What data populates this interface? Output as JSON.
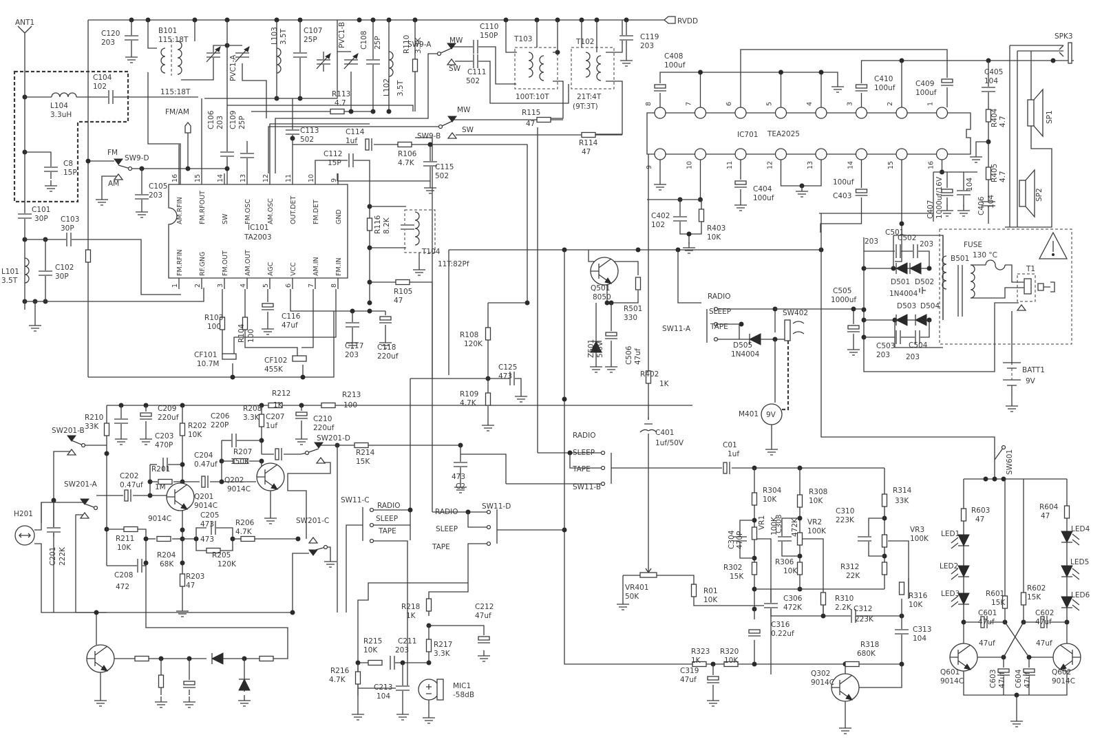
{
  "title": "AM/FM radio cassette schematic",
  "colors": {
    "ink": "#3a3a3a",
    "background": "#ffffff"
  },
  "nets": {
    "rvdd": "RVDD",
    "fm_am": "FM/AM"
  },
  "antenna": {
    "ref": "ANT1"
  },
  "ic101": {
    "ref": "IC101",
    "part": "TA2003",
    "top_pins": [
      {
        "n": "16",
        "name": "AM.RFIN"
      },
      {
        "n": "15",
        "name": "FM.RFOUT"
      },
      {
        "n": "14",
        "name": "SW"
      },
      {
        "n": "13",
        "name": "FM.OSC"
      },
      {
        "n": "12",
        "name": "AM.OSC"
      },
      {
        "n": "11",
        "name": "OUT.DET"
      },
      {
        "n": "10",
        "name": "FM.DET"
      },
      {
        "n": "9",
        "name": "GND"
      }
    ],
    "bottom_pins": [
      {
        "n": "1",
        "name": "FM.RFIN"
      },
      {
        "n": "2",
        "name": "RF.GNG"
      },
      {
        "n": "3",
        "name": "FM.OUT"
      },
      {
        "n": "4",
        "name": "AM.OUT"
      },
      {
        "n": "5",
        "name": "AGC"
      },
      {
        "n": "6",
        "name": "VCC"
      },
      {
        "n": "7",
        "name": "AM.IN"
      },
      {
        "n": "8",
        "name": "FM.IN"
      }
    ]
  },
  "ic701": {
    "ref": "IC701",
    "part": "TEA2025",
    "top_pins": [
      "8",
      "7",
      "6",
      "5",
      "4",
      "3",
      "2",
      "1"
    ],
    "bottom_pins": [
      "9",
      "10",
      "11",
      "12",
      "13",
      "14",
      "15",
      "16"
    ]
  },
  "components": {
    "C120": {
      "ref": "C120",
      "value": "203"
    },
    "B101": {
      "ref": "B101",
      "value": "115:18T"
    },
    "PVC1A": {
      "ref": "PVC1-A",
      "value": ""
    },
    "PVC1B": {
      "ref": "PVC1-B",
      "value": ""
    },
    "L103": {
      "ref": "L103",
      "value": "3.5T"
    },
    "C107": {
      "ref": "C107",
      "value": "25P"
    },
    "C108": {
      "ref": "C108",
      "value": "25P"
    },
    "L102": {
      "ref": "L102",
      "value": "3.5T"
    },
    "R110": {
      "ref": "R110",
      "value": "3.3K"
    },
    "C110": {
      "ref": "C110",
      "value": "150P"
    },
    "C111": {
      "ref": "C111",
      "value": "502"
    },
    "T103": {
      "ref": "T103",
      "value": "100T:10T"
    },
    "T102": {
      "ref": "T102",
      "value": "21T:4T",
      "value2": "(9T:3T)"
    },
    "C119": {
      "ref": "C119",
      "value": "203"
    },
    "C104": {
      "ref": "C104",
      "value": "102"
    },
    "L104": {
      "ref": "L104",
      "value": "3.3uH"
    },
    "C8": {
      "ref": "C8",
      "value": "15P"
    },
    "R113": {
      "ref": "R113",
      "value": "4.7"
    },
    "C106": {
      "ref": "C106",
      "value": "203"
    },
    "C109": {
      "ref": "C109",
      "value": "25P"
    },
    "C113": {
      "ref": "C113",
      "value": "502"
    },
    "C114": {
      "ref": "C114",
      "value": "1uf"
    },
    "R106": {
      "ref": "R106",
      "value": "4.7K"
    },
    "C115": {
      "ref": "C115",
      "value": "502"
    },
    "C112": {
      "ref": "C112",
      "value": "15P"
    },
    "R115": {
      "ref": "R115",
      "value": "47"
    },
    "R114": {
      "ref": "R114",
      "value": "47"
    },
    "C105": {
      "ref": "C105",
      "value": "203"
    },
    "C101": {
      "ref": "C101",
      "value": "30P"
    },
    "C103": {
      "ref": "C103",
      "value": "30P"
    },
    "L101": {
      "ref": "L101",
      "value": "3.5T"
    },
    "C102": {
      "ref": "C102",
      "value": "30P"
    },
    "R116": {
      "ref": "R116",
      "value": "8.2K"
    },
    "T104": {
      "ref": "T104",
      "value": "11T:82Pf"
    },
    "R105": {
      "ref": "R105",
      "value": "47"
    },
    "R103": {
      "ref": "R103",
      "value": "100"
    },
    "R104": {
      "ref": "R104",
      "value": "100"
    },
    "C116": {
      "ref": "C116",
      "value": "47uf"
    },
    "C117": {
      "ref": "C117",
      "value": "203"
    },
    "C118": {
      "ref": "C118",
      "value": "220uf"
    },
    "CF101": {
      "ref": "CF101",
      "value": "10.7M"
    },
    "CF102": {
      "ref": "CF102",
      "value": "455K"
    },
    "R108": {
      "ref": "R108",
      "value": "120K"
    },
    "C125": {
      "ref": "C125",
      "value": "473"
    },
    "R109": {
      "ref": "R109",
      "value": "4.7K"
    },
    "Q501": {
      "ref": "Q501",
      "value": "8050"
    },
    "R501": {
      "ref": "R501",
      "value": "330"
    },
    "Z501": {
      "ref": "Z501",
      "value": "5.6V"
    },
    "C506": {
      "ref": "C506",
      "value": "47uf"
    },
    "C408": {
      "ref": "C408",
      "value": "100uf"
    },
    "C410": {
      "ref": "C410",
      "value": "100uf"
    },
    "C409": {
      "ref": "C409",
      "value": "100uf"
    },
    "C405": {
      "ref": "C405",
      "value": "104"
    },
    "R404": {
      "ref": "R404",
      "value": "4.7"
    },
    "R405": {
      "ref": "R405",
      "value": "4.7"
    },
    "C406": {
      "ref": "C406",
      "value": "104"
    },
    "C407": {
      "ref": "C407",
      "value": "1000uf/16V"
    },
    "C407b": {
      "ref": "",
      "value": "104"
    },
    "C404": {
      "ref": "C404",
      "value": "100uf"
    },
    "C403": {
      "ref": "C403",
      "value": "100uf"
    },
    "C402": {
      "ref": "C402",
      "value": "102"
    },
    "R403": {
      "ref": "R403",
      "value": "10K"
    },
    "SPK3": {
      "ref": "SPK3",
      "value": ""
    },
    "SP1": {
      "ref": "SP1",
      "value": ""
    },
    "SP2": {
      "ref": "SP2",
      "value": ""
    },
    "C501": {
      "ref": "C501",
      "value": "203"
    },
    "C502": {
      "ref": "C502",
      "value": "203"
    },
    "C503": {
      "ref": "C503",
      "value": "203"
    },
    "C504": {
      "ref": "C504",
      "value": "203"
    },
    "D501": {
      "ref": "D501",
      "value": "1N4004"
    },
    "D502": {
      "ref": "D502",
      "value": ""
    },
    "D503": {
      "ref": "D503",
      "value": ""
    },
    "D504": {
      "ref": "D504",
      "value": ""
    },
    "B501": {
      "ref": "B501",
      "value": ""
    },
    "FUSE": {
      "ref": "FUSE",
      "value": "130 °C"
    },
    "T1": {
      "ref": "T1",
      "value": ""
    },
    "C505": {
      "ref": "C505",
      "value": "1000uf"
    },
    "BATT1": {
      "ref": "BATT1",
      "value": "9V"
    },
    "D505": {
      "ref": "D505",
      "value": "1N4004"
    },
    "SW402": {
      "ref": "SW402",
      "value": ""
    },
    "M401": {
      "ref": "M401",
      "value": "9V"
    },
    "R402": {
      "ref": "R402",
      "value": "1K"
    },
    "C401": {
      "ref": "C401",
      "value": "1uf/50V"
    },
    "C01": {
      "ref": "C01",
      "value": "1uf"
    },
    "VR401": {
      "ref": "VR401",
      "value": "50K"
    },
    "R01": {
      "ref": "R01",
      "value": "10K"
    },
    "R304": {
      "ref": "R304",
      "value": "10K"
    },
    "R308": {
      "ref": "R308",
      "value": "10K"
    },
    "R314": {
      "ref": "R314",
      "value": "33K"
    },
    "C304": {
      "ref": "C304",
      "value": "470P"
    },
    "VR1": {
      "ref": "VR1",
      "value": "100K"
    },
    "C308": {
      "ref": "C308",
      "value": "472K"
    },
    "VR2": {
      "ref": "VR2",
      "value": "100K"
    },
    "C310": {
      "ref": "C310",
      "value": "223K"
    },
    "VR3": {
      "ref": "VR3",
      "value": "100K"
    },
    "R302": {
      "ref": "R302",
      "value": "15K"
    },
    "R306": {
      "ref": "R306",
      "value": "10K"
    },
    "R312": {
      "ref": "R312",
      "value": "22K"
    },
    "C306": {
      "ref": "C306",
      "value": "472K"
    },
    "R310": {
      "ref": "R310",
      "value": "2.2K"
    },
    "R316": {
      "ref": "R316",
      "value": "10K"
    },
    "C312": {
      "ref": "C312",
      "value": "223K"
    },
    "C316": {
      "ref": "C316",
      "value": "0.22uf"
    },
    "C313": {
      "ref": "C313",
      "value": "104"
    },
    "R323": {
      "ref": "R323",
      "value": "1K"
    },
    "R320": {
      "ref": "R320",
      "value": "10K"
    },
    "R318": {
      "ref": "R318",
      "value": "680K"
    },
    "C319": {
      "ref": "C319",
      "value": "47uf"
    },
    "Q302": {
      "ref": "Q302",
      "value": "9014C"
    },
    "SW601": {
      "ref": "SW601",
      "value": ""
    },
    "R603": {
      "ref": "R603",
      "value": "47"
    },
    "R604": {
      "ref": "R604",
      "value": "47"
    },
    "R601": {
      "ref": "R601",
      "value": "15K"
    },
    "R602": {
      "ref": "R602",
      "value": "15K"
    },
    "C601": {
      "ref": "C601",
      "value": "47uf"
    },
    "C602": {
      "ref": "C602",
      "value": "47uf"
    },
    "C603": {
      "ref": "C603",
      "value": "47uf"
    },
    "C604": {
      "ref": "C604",
      "value": "47uf"
    },
    "Q601": {
      "ref": "Q601",
      "value": "9014C"
    },
    "Q602": {
      "ref": "Q602",
      "value": "9014C"
    },
    "LED1": {
      "ref": "LED1",
      "value": ""
    },
    "LED2": {
      "ref": "LED2",
      "value": ""
    },
    "LED3": {
      "ref": "LED3",
      "value": ""
    },
    "LED4": {
      "ref": "LED4",
      "value": ""
    },
    "LED5": {
      "ref": "LED5",
      "value": ""
    },
    "LED6": {
      "ref": "LED6",
      "value": ""
    },
    "R210": {
      "ref": "R210",
      "value": "33K"
    },
    "C209": {
      "ref": "C209",
      "value": "220uf"
    },
    "R202": {
      "ref": "R202",
      "value": "10K"
    },
    "C206": {
      "ref": "C206",
      "value": "220P"
    },
    "R208": {
      "ref": "R208",
      "value": "3.3K"
    },
    "R212": {
      "ref": "R212",
      "value": "1K"
    },
    "R213": {
      "ref": "R213",
      "value": "100"
    },
    "C210": {
      "ref": "C210",
      "value": "220uf"
    },
    "C203": {
      "ref": "C203",
      "value": "470P"
    },
    "C207": {
      "ref": "C207",
      "value": "1uf"
    },
    "R207": {
      "ref": "R207",
      "value": "150K"
    },
    "R201": {
      "ref": "R201",
      "value": "1M"
    },
    "C204": {
      "ref": "C204",
      "value": "0.47uf"
    },
    "C202": {
      "ref": "C202",
      "value": "0.47uf"
    },
    "Q201": {
      "ref": "Q201",
      "value": "9014C"
    },
    "Q202": {
      "ref": "Q202",
      "value": "9014C"
    },
    "R214": {
      "ref": "R214",
      "value": "15K"
    },
    "C2": {
      "ref": "C2",
      "value": "473"
    },
    "H201": {
      "ref": "H201",
      "value": ""
    },
    "C201": {
      "ref": "C201",
      "value": "222K"
    },
    "R211": {
      "ref": "R211",
      "value": "10K"
    },
    "C208": {
      "ref": "C208",
      "value": "472"
    },
    "R204": {
      "ref": "R204",
      "value": "68K"
    },
    "C205": {
      "ref": "C205",
      "value": "473"
    },
    "R205": {
      "ref": "R205",
      "value": "120K"
    },
    "R206": {
      "ref": "R206",
      "value": "4.7K"
    },
    "R203": {
      "ref": "R203",
      "value": "47"
    },
    "R218": {
      "ref": "R218",
      "value": "1K"
    },
    "C212": {
      "ref": "C212",
      "value": "47uf"
    },
    "R215": {
      "ref": "R215",
      "value": "10K"
    },
    "C211": {
      "ref": "C211",
      "value": "203"
    },
    "R217": {
      "ref": "R217",
      "value": "3.3K"
    },
    "R216": {
      "ref": "R216",
      "value": "4.7K"
    },
    "C213": {
      "ref": "C213",
      "value": "104"
    },
    "MIC1": {
      "ref": "MIC1",
      "value": "-58dB"
    }
  },
  "switches": {
    "SW9A": {
      "ref": "SW9-A",
      "pos": [
        "MW",
        "SW"
      ]
    },
    "SW9B": {
      "ref": "SW9-B",
      "pos": [
        "MW",
        "SW"
      ]
    },
    "SW9D": {
      "ref": "SW9-D",
      "pos": [
        "FM",
        "AM"
      ]
    },
    "SW11A": {
      "ref": "SW11-A",
      "pos": [
        "RADIO",
        "SLEEP",
        "TAPE"
      ]
    },
    "SW11B": {
      "ref": "SW11-B",
      "pos": [
        "RADIO",
        "SLEEP",
        "TAPE"
      ]
    },
    "SW11C": {
      "ref": "SW11-C",
      "pos": [
        "RADIO",
        "SLEEP",
        "TAPE"
      ]
    },
    "SW11D": {
      "ref": "SW11-D",
      "pos": [
        "RADIO",
        "SLEEP",
        "TAPE"
      ]
    },
    "SW201A": {
      "ref": "SW201-A"
    },
    "SW201B": {
      "ref": "SW201-B"
    },
    "SW201C": {
      "ref": "SW201-C"
    },
    "SW201D": {
      "ref": "SW201-D"
    }
  }
}
